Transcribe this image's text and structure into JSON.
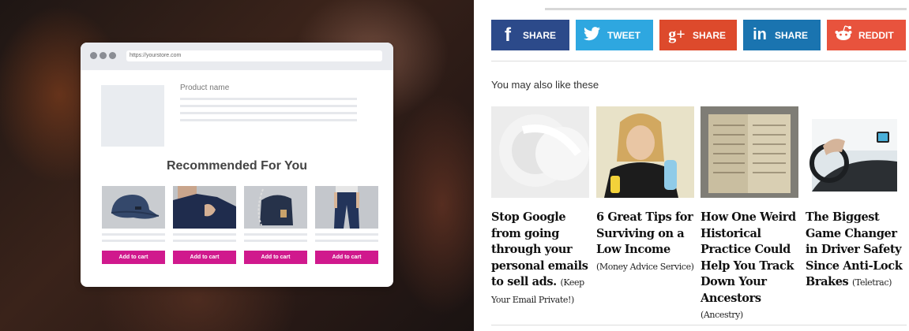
{
  "left": {
    "url": "https://yourstore.com",
    "product_name": "Product name",
    "recommended_title": "Recommended For You",
    "add_to_cart": "Add to cart"
  },
  "share": {
    "facebook": "SHARE",
    "twitter": "TWEET",
    "gplus": "SHARE",
    "linkedin": "SHARE",
    "reddit": "REDDIT",
    "colors": {
      "facebook": "#2c4a8a",
      "twitter": "#2ea7e0",
      "gplus": "#dd4a2c",
      "linkedin": "#1a74b0",
      "reddit": "#e8533d"
    }
  },
  "related": {
    "title": "You may also like these",
    "items": [
      {
        "title": "Stop Google from going through your personal emails to sell ads.",
        "source": "(Keep Your Email Private!)"
      },
      {
        "title": "6 Great Tips for Surviving on a Low Income",
        "source": "(Money Advice Service)"
      },
      {
        "title": "How One Weird Historical Practice Could Help You Track Down Your Ancestors",
        "source": "(Ancestry)"
      },
      {
        "title": "The Biggest Game Changer in Driver Safety Since Anti-Lock Brakes",
        "source": "(Teletrac)"
      }
    ]
  }
}
